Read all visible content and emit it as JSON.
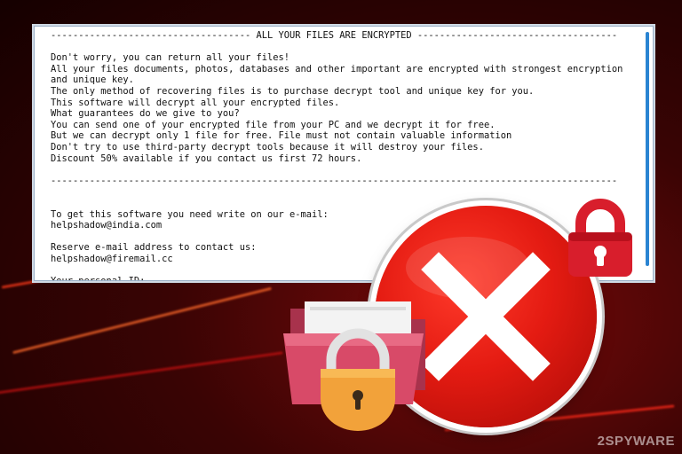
{
  "ransom_note": {
    "lines": [
      "------------------------------------ ALL YOUR FILES ARE ENCRYPTED ------------------------------------",
      "",
      "Don't worry, you can return all your files!",
      "All your files documents, photos, databases and other important are encrypted with strongest encryption",
      "and unique key.",
      "The only method of recovering files is to purchase decrypt tool and unique key for you.",
      "This software will decrypt all your encrypted files.",
      "What guarantees do we give to you?",
      "You can send one of your encrypted file from your PC and we decrypt it for free.",
      "But we can decrypt only 1 file for free. File must not contain valuable information",
      "Don't try to use third-party decrypt tools because it will destroy your files.",
      "Discount 50% available if you contact us first 72 hours.",
      "",
      "------------------------------------------------------------------------------------------------------",
      "",
      "",
      "To get this software you need write on our e-mail:",
      "helpshadow@india.com",
      "",
      "Reserve e-mail address to contact us:",
      "helpshadow@firemail.cc",
      "",
      "Your personal ID:"
    ]
  },
  "watermark": "2SPYWARE",
  "icons": {
    "error": "close-x-circle-icon",
    "lock": "padlock-icon",
    "folder": "locked-folder-icon"
  },
  "colors": {
    "accent_red": "#e41b12",
    "lock_red": "#d81e2c",
    "lock_orange": "#f2a23a",
    "folder_pink": "#d84a68",
    "scrollbar_blue": "#2a84d2"
  }
}
